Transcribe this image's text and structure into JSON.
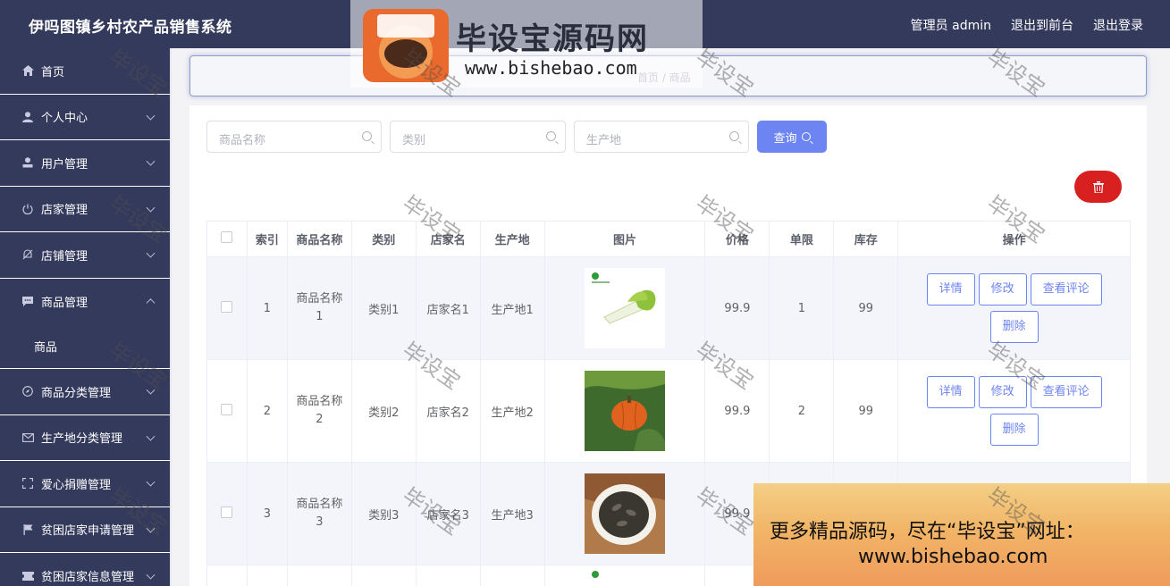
{
  "header": {
    "title": "伊吗图镇乡村农产品销售系统",
    "admin_label": "管理员 admin",
    "front_link": "退出到前台",
    "logout_link": "退出登录"
  },
  "sidebar": {
    "items": [
      {
        "label": "首页",
        "icon": "home-icon"
      },
      {
        "label": "个人中心",
        "icon": "user-icon"
      },
      {
        "label": "用户管理",
        "icon": "user-manage-icon"
      },
      {
        "label": "店家管理",
        "icon": "power-icon"
      },
      {
        "label": "店铺管理",
        "icon": "bell-off-icon"
      },
      {
        "label": "商品管理",
        "icon": "message-icon"
      },
      {
        "label": "商品分类管理",
        "icon": "compass-icon"
      },
      {
        "label": "生产地分类管理",
        "icon": "mail-icon"
      },
      {
        "label": "爱心捐赠管理",
        "icon": "fullscreen-icon"
      },
      {
        "label": "贫困店家申请管理",
        "icon": "flag-icon"
      },
      {
        "label": "贫困店家信息管理",
        "icon": "ticket-icon"
      }
    ],
    "subitem": "商品"
  },
  "breadcrumb": {
    "text": "首页 / 商品"
  },
  "search": {
    "name_placeholder": "商品名称",
    "category_placeholder": "类别",
    "origin_placeholder": "生产地",
    "query_button": "查询"
  },
  "table": {
    "headers": [
      "索引",
      "商品名称",
      "类别",
      "店家名",
      "生产地",
      "图片",
      "价格",
      "单限",
      "库存",
      "操作"
    ],
    "rows": [
      {
        "index": "1",
        "name": "商品名称1",
        "category": "类别1",
        "store": "店家名1",
        "origin": "生产地1",
        "image": "bok-choy",
        "price": "99.9",
        "limit": "1",
        "stock": "99"
      },
      {
        "index": "2",
        "name": "商品名称2",
        "category": "类别2",
        "store": "店家名2",
        "origin": "生产地2",
        "image": "pumpkin",
        "price": "99.9",
        "limit": "2",
        "stock": "99"
      },
      {
        "index": "3",
        "name": "商品名称3",
        "category": "类别3",
        "store": "店家名3",
        "origin": "生产地3",
        "image": "dried-beans",
        "price": "99.9",
        "limit": "",
        "stock": ""
      }
    ],
    "actions": {
      "detail": "详情",
      "edit": "修改",
      "review": "查看评论",
      "delete": "删除"
    }
  },
  "watermark": {
    "stamp": "毕设宝",
    "logo_name": "毕设宝源码网",
    "logo_url": "www.bishebao.com",
    "promo_line1": "更多精品源码，尽在“毕设宝”网址：",
    "promo_line2": "www.bishebao.com"
  },
  "colors": {
    "sidebar": "#343a5c",
    "accent": "#6d84f3",
    "danger": "#d92020"
  }
}
